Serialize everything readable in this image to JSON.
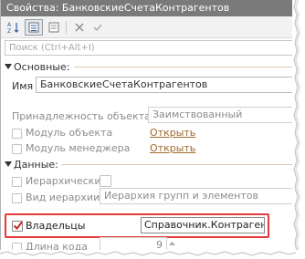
{
  "window": {
    "title": "Свойства: БанковскиеСчетаКонтрагентов"
  },
  "toolbar": {
    "buttons": [
      {
        "icon": "sort-az-icon"
      },
      {
        "icon": "categories-icon"
      },
      {
        "icon": "collapse-icon"
      },
      {
        "icon": "delete-icon"
      },
      {
        "icon": "confirm-icon"
      }
    ]
  },
  "search": {
    "placeholder": "Поиск (Ctrl+Alt+I)"
  },
  "sections": {
    "main": {
      "title": "Основные:"
    },
    "data": {
      "title": "Данные:"
    }
  },
  "props": {
    "name": {
      "label": "Имя",
      "value": "БанковскиеСчетаКонтрагентов"
    },
    "ownership": {
      "label": "Принадлежность объекта",
      "value": "Заимствованный"
    },
    "object_module": {
      "label": "Модуль объекта",
      "link": "Открыть"
    },
    "manager_module": {
      "label": "Модуль менеджера",
      "link": "Открыть"
    },
    "hierarchical": {
      "label": "Иерархический"
    },
    "hierarchy_type": {
      "label": "Вид иерархии",
      "value": "Иерархия групп и элементов"
    },
    "owners": {
      "label": "Владельцы",
      "value": "Справочник.Контрагенты",
      "checked": true
    },
    "code_length": {
      "label": "Длина кода",
      "value": "9"
    }
  },
  "colors": {
    "title_bar": "#7a7a7a",
    "link": "#9c6a2b",
    "highlight": "#e53b3b",
    "check": "#cc2222"
  }
}
